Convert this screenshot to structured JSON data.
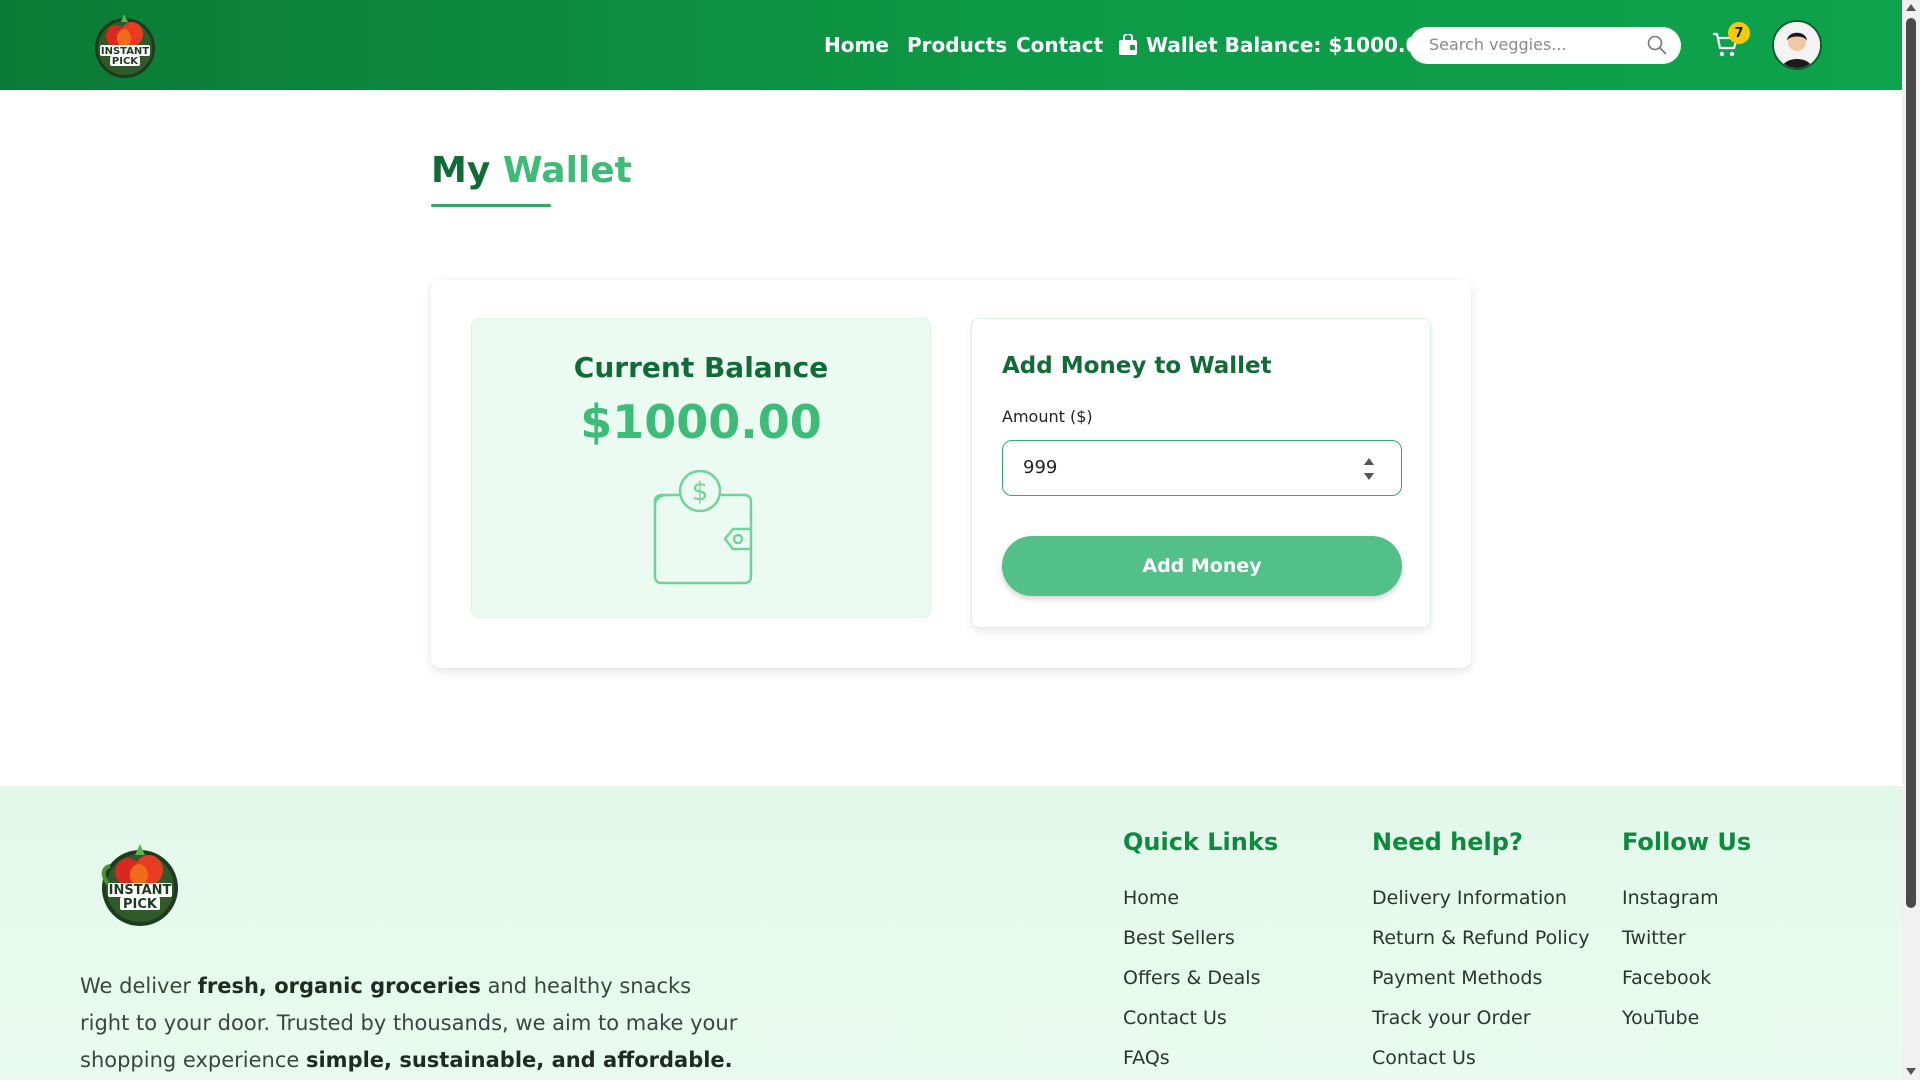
{
  "header": {
    "logo_text": "INSTANT PICK",
    "nav": [
      "Home",
      "Products",
      "Contact"
    ],
    "wallet_balance": "Wallet Balance: $1000.00",
    "search_placeholder": "Search veggies...",
    "cart_count": "7",
    "icons": {
      "search": "search-icon",
      "cart": "cart-icon",
      "wallet": "wallet-bag-icon",
      "avatar": "user-avatar"
    }
  },
  "main": {
    "title_part1": "My",
    "title_part2": "Wallet",
    "balance_title": "Current Balance",
    "balance_amount": "$1000.00",
    "add_title": "Add Money to Wallet",
    "amount_label": "Amount ($)",
    "amount_value": "999",
    "add_button": "Add Money"
  },
  "footer": {
    "desc_1": "We deliver ",
    "desc_2": "fresh, organic groceries",
    "desc_3": " and healthy snacks right to your door. Trusted by thousands, we aim to make your shopping experience ",
    "desc_4": "simple, sustainable, and affordable.",
    "columns": [
      {
        "title": "Quick Links",
        "links": [
          "Home",
          "Best Sellers",
          "Offers & Deals",
          "Contact Us",
          "FAQs"
        ]
      },
      {
        "title": "Need help?",
        "links": [
          "Delivery Information",
          "Return & Refund Policy",
          "Payment Methods",
          "Track your Order",
          "Contact Us"
        ]
      },
      {
        "title": "Follow Us",
        "links": [
          "Instagram",
          "Twitter",
          "Facebook",
          "YouTube"
        ]
      }
    ]
  },
  "colors": {
    "header_green": "#0d9a46",
    "brand_dark": "#106b36",
    "brand_light": "#3dbb78",
    "button": "#53c089",
    "badge": "#f6c90e"
  }
}
